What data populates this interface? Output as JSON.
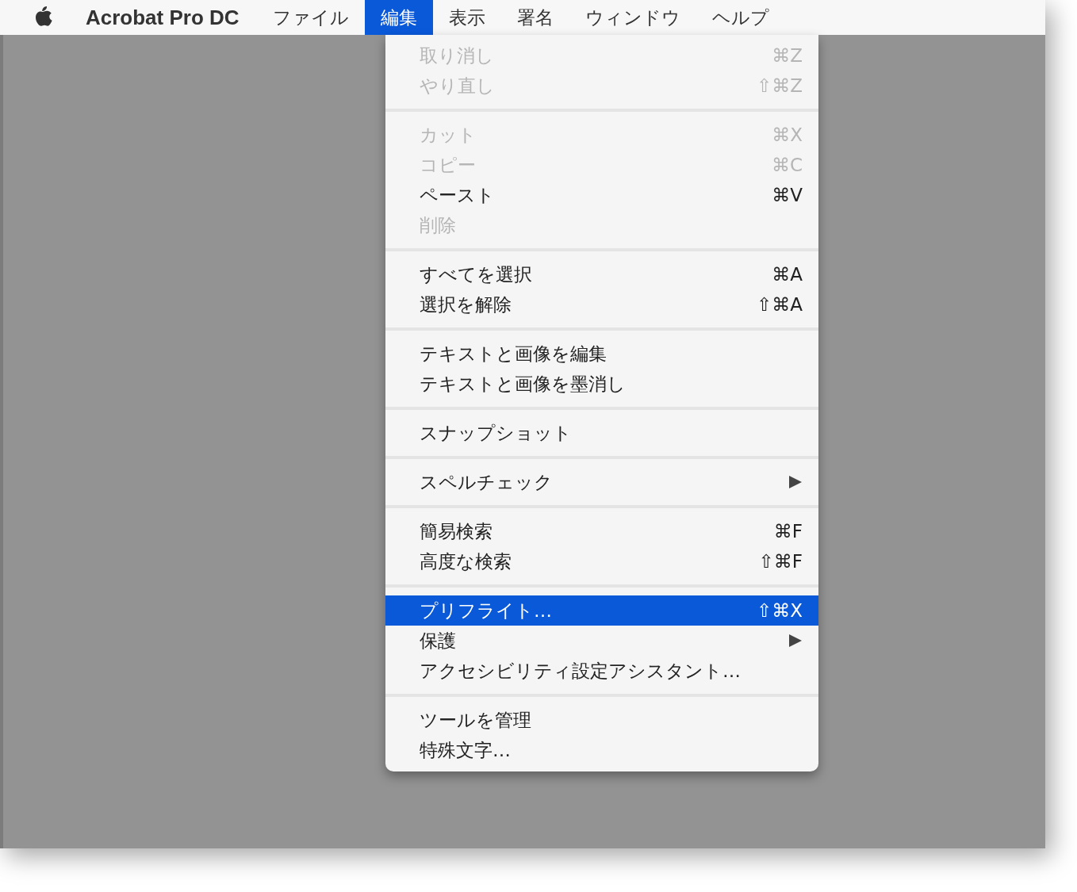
{
  "menubar": {
    "app_name": "Acrobat Pro DC",
    "menus": [
      {
        "label": "ファイル",
        "selected": false
      },
      {
        "label": "編集",
        "selected": true
      },
      {
        "label": "表示",
        "selected": false
      },
      {
        "label": "署名",
        "selected": false
      },
      {
        "label": "ウィンドウ",
        "selected": false
      },
      {
        "label": "ヘルプ",
        "selected": false
      }
    ]
  },
  "dropdown": {
    "groups": [
      {
        "items": [
          {
            "label": "取り消し",
            "shortcut": "⌘Z",
            "disabled": true,
            "selected": false,
            "submenu": false
          },
          {
            "label": "やり直し",
            "shortcut": "⇧⌘Z",
            "disabled": true,
            "selected": false,
            "submenu": false
          }
        ]
      },
      {
        "items": [
          {
            "label": "カット",
            "shortcut": "⌘X",
            "disabled": true,
            "selected": false,
            "submenu": false
          },
          {
            "label": "コピー",
            "shortcut": "⌘C",
            "disabled": true,
            "selected": false,
            "submenu": false
          },
          {
            "label": "ペースト",
            "shortcut": "⌘V",
            "disabled": false,
            "selected": false,
            "submenu": false
          },
          {
            "label": "削除",
            "disabled": true,
            "selected": false,
            "submenu": false
          }
        ]
      },
      {
        "items": [
          {
            "label": "すべてを選択",
            "shortcut": "⌘A",
            "disabled": false,
            "selected": false,
            "submenu": false
          },
          {
            "label": "選択を解除",
            "shortcut": "⇧⌘A",
            "disabled": false,
            "selected": false,
            "submenu": false
          }
        ]
      },
      {
        "items": [
          {
            "label": "テキストと画像を編集",
            "disabled": false,
            "selected": false,
            "submenu": false
          },
          {
            "label": "テキストと画像を墨消し",
            "disabled": false,
            "selected": false,
            "submenu": false
          }
        ]
      },
      {
        "items": [
          {
            "label": "スナップショット",
            "disabled": false,
            "selected": false,
            "submenu": false
          }
        ]
      },
      {
        "items": [
          {
            "label": "スペルチェック",
            "disabled": false,
            "selected": false,
            "submenu": true
          }
        ]
      },
      {
        "items": [
          {
            "label": "簡易検索",
            "shortcut": "⌘F",
            "disabled": false,
            "selected": false,
            "submenu": false
          },
          {
            "label": "高度な検索",
            "shortcut": "⇧⌘F",
            "disabled": false,
            "selected": false,
            "submenu": false
          }
        ]
      },
      {
        "items": [
          {
            "label": "プリフライト…",
            "shortcut": "⇧⌘X",
            "disabled": false,
            "selected": true,
            "submenu": false
          },
          {
            "label": "保護",
            "disabled": false,
            "selected": false,
            "submenu": true
          },
          {
            "label": "アクセシビリティ設定アシスタント…",
            "disabled": false,
            "selected": false,
            "submenu": false
          }
        ]
      },
      {
        "items": [
          {
            "label": "ツールを管理",
            "disabled": false,
            "selected": false,
            "submenu": false
          },
          {
            "label": "特殊文字…",
            "disabled": false,
            "selected": false,
            "submenu": false
          }
        ]
      }
    ]
  }
}
